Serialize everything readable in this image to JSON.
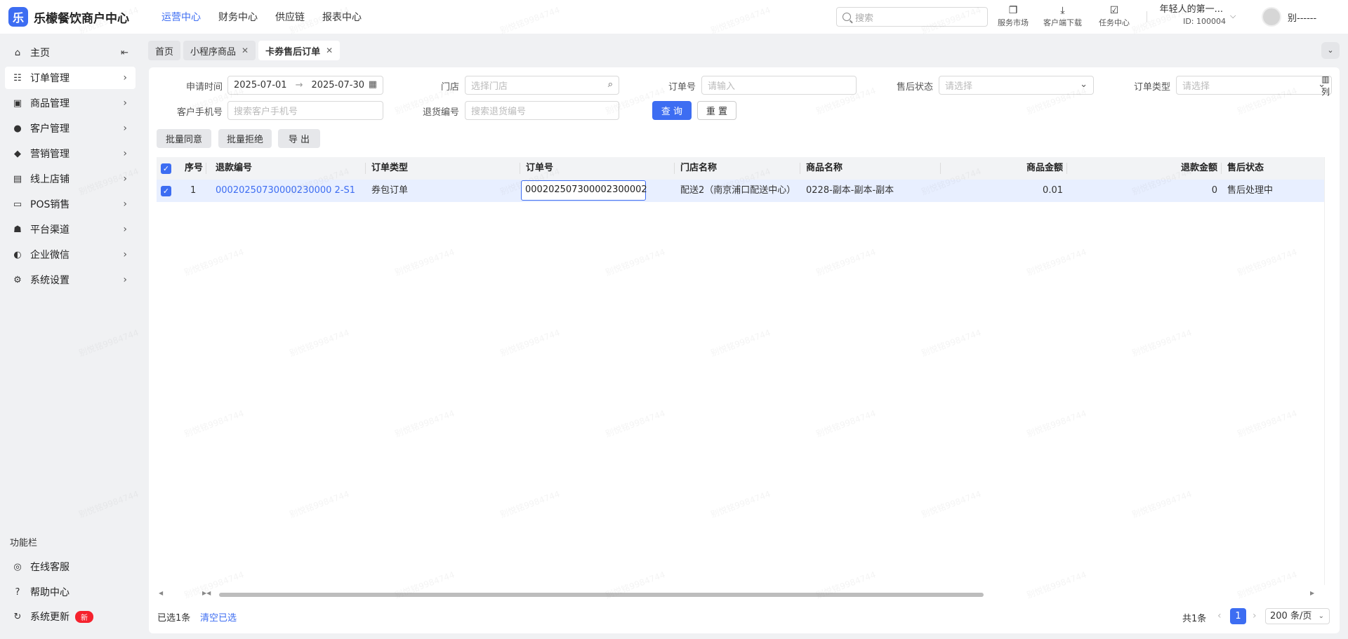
{
  "app": {
    "title": "乐檬餐饮商户中心",
    "logo_glyph": "乐"
  },
  "topnav": [
    {
      "label": "运营中心",
      "active": true
    },
    {
      "label": "财务中心"
    },
    {
      "label": "供应链"
    },
    {
      "label": "报表中心"
    }
  ],
  "search": {
    "placeholder": "搜索"
  },
  "quick": {
    "service_market": "服务市场",
    "client_download": "客户端下载",
    "task_center": "任务中心"
  },
  "account": {
    "name": "年轻人的第一...",
    "id": "ID: 100004"
  },
  "user": {
    "name": "别------"
  },
  "sidebar": {
    "items": [
      {
        "label": "主页",
        "icon": "home-icon"
      },
      {
        "label": "订单管理",
        "icon": "order-icon"
      },
      {
        "label": "商品管理",
        "icon": "goods-icon"
      },
      {
        "label": "客户管理",
        "icon": "user-icon"
      },
      {
        "label": "营销管理",
        "icon": "tag-icon"
      },
      {
        "label": "线上店铺",
        "icon": "store-icon"
      },
      {
        "label": "POS销售",
        "icon": "pos-icon"
      },
      {
        "label": "平台渠道",
        "icon": "bank-icon"
      },
      {
        "label": "企业微信",
        "icon": "chat-icon"
      },
      {
        "label": "系统设置",
        "icon": "gear-icon"
      }
    ],
    "func_title": "功能栏",
    "func_items": [
      {
        "label": "在线客服",
        "icon": "headset-icon"
      },
      {
        "label": "帮助中心",
        "icon": "help-icon"
      },
      {
        "label": "系统更新",
        "icon": "refresh-icon",
        "badge": "新"
      }
    ]
  },
  "tabs": [
    {
      "label": "首页"
    },
    {
      "label": "小程序商品",
      "closable": true
    },
    {
      "label": "卡券售后订单",
      "closable": true,
      "active": true
    }
  ],
  "filters": {
    "apply_time_label": "申请时间",
    "date_start": "2025-07-01",
    "date_sep": "→",
    "date_end": "2025-07-30",
    "store_label": "门店",
    "store_placeholder": "选择门店",
    "order_no_label": "订单号",
    "order_no_placeholder": "请输入",
    "aftersale_status_label": "售后状态",
    "aftersale_status_placeholder": "请选择",
    "order_type_label": "订单类型",
    "order_type_placeholder": "请选择",
    "phone_label": "客户手机号",
    "phone_placeholder": "搜索客户手机号",
    "return_no_label": "退货编号",
    "return_no_placeholder": "搜索退货编号",
    "query_button": "查 询",
    "reset_button": "重 置"
  },
  "actions": {
    "batch_agree": "批量同意",
    "batch_reject": "批量拒绝",
    "export": "导 出"
  },
  "table": {
    "columns": [
      "序号",
      "退款编号",
      "订单类型",
      "订单号",
      "门店名称",
      "商品名称",
      "商品金额",
      "退款金额",
      "售后状态"
    ],
    "rows": [
      {
        "index": "1",
        "refund_no": "00020250730000230000 2-S1",
        "order_type": "券包订单",
        "order_no": "000202507300002300002",
        "store_name": "配送2（南京浦口配送中心）",
        "goods_name": "0228-副本-副本-副本",
        "goods_amount": "0.01",
        "refund_amount": "0",
        "status": "售后处理中"
      }
    ],
    "column_setting_label": "列"
  },
  "footer": {
    "selected": "已选1条",
    "clear": "清空已选",
    "total": "共1条",
    "current_page": "1",
    "page_size": "200 条/页"
  },
  "watermark": "别悦铭9984744",
  "colors": {
    "primary": "#3d6df2",
    "badge": "#f5222d"
  }
}
